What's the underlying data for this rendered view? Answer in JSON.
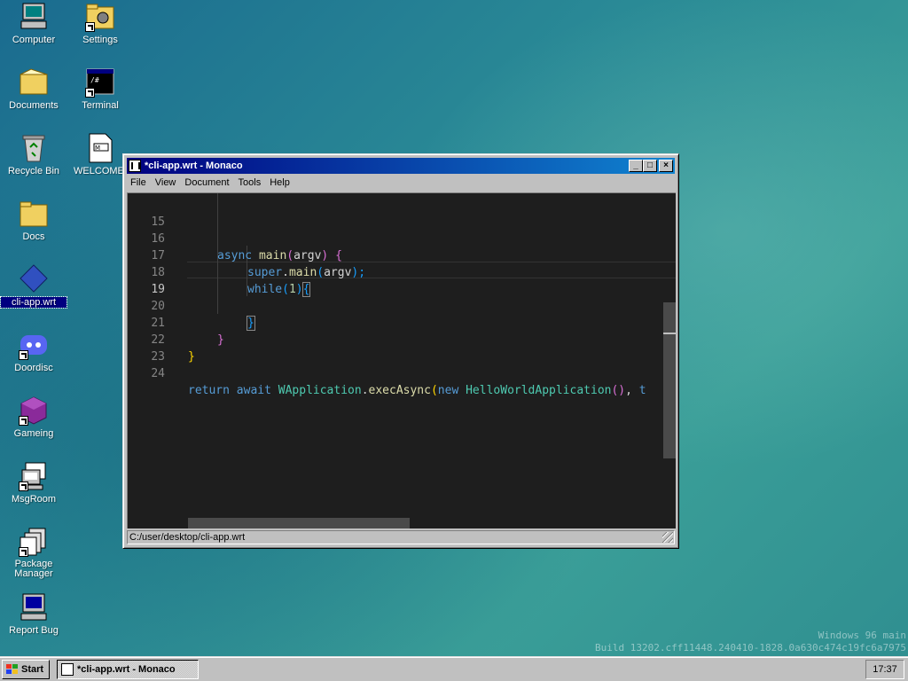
{
  "desktop": {
    "icons": [
      {
        "label": "Computer"
      },
      {
        "label": "Settings"
      },
      {
        "label": "Documents"
      },
      {
        "label": "Terminal"
      },
      {
        "label": "Recycle Bin"
      },
      {
        "label": "WELCOME."
      },
      {
        "label": "Docs"
      },
      {
        "label": "cli-app.wrt"
      },
      {
        "label": "Doordisc"
      },
      {
        "label": "Gameing"
      },
      {
        "label": "MsgRoom"
      },
      {
        "label": "Package Manager"
      },
      {
        "label": "Report Bug"
      }
    ]
  },
  "window": {
    "title": "*cli-app.wrt - Monaco",
    "menu": [
      "File",
      "View",
      "Document",
      "Tools",
      "Help"
    ],
    "status_path": "C:/user/desktop/cli-app.wrt",
    "buttons": {
      "minimize": "_",
      "maximize": "□",
      "close": "×"
    }
  },
  "editor": {
    "line_numbers": [
      "15",
      "16",
      "17",
      "18",
      "19",
      "20",
      "21",
      "22",
      "23",
      "24"
    ],
    "current_line": "19",
    "tokens": {
      "l16": [
        "async",
        "main",
        "(",
        "argv",
        ")",
        "{"
      ],
      "l17": [
        "super",
        ".",
        "main",
        "(",
        "argv",
        ");"
      ],
      "l18": [
        "while",
        "(",
        "1",
        ")",
        "{"
      ],
      "l20": [
        "}"
      ],
      "l21": [
        "}"
      ],
      "l22": [
        "}"
      ],
      "l24": [
        "return",
        "await",
        "WApplication",
        ".",
        "execAsync",
        "(",
        "new",
        "HelloWorldApplication",
        "()",
        ",",
        "t"
      ]
    }
  },
  "watermark": {
    "line1": "Windows 96 main",
    "line2": "Build 13202.cff11448.240410-1828.0a630c474c19fc6a7975"
  },
  "taskbar": {
    "start_label": "Start",
    "task_label": "*cli-app.wrt - Monaco",
    "clock": "17:37"
  },
  "colors": {
    "titlebar": "#000080",
    "editor_bg": "#1e1e1e",
    "keyword": "#569cd6",
    "function": "#dcdcaa",
    "class": "#4ec9b0"
  }
}
